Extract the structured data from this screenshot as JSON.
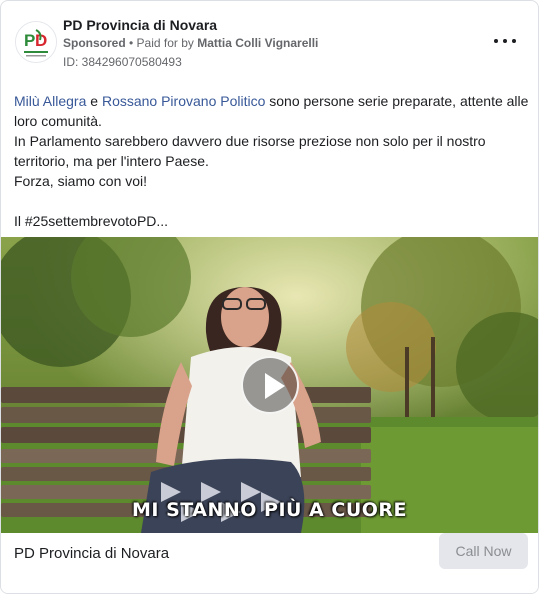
{
  "post": {
    "page_name": "PD Provincia di Novara",
    "sponsored": "Sponsored",
    "separator": " • ",
    "paid_for_prefix": "Paid for by ",
    "paid_for_name": "Mattia Colli Vignarelli",
    "ad_id": "ID: 384296070580493",
    "more_icon": "more-horizontal-icon"
  },
  "body": {
    "link1": "Milù Allegra",
    "and_word": " e ",
    "link2": "Rossano Pirovano Politico",
    "line1_rest": " sono persone serie preparate, attente alle loro comunità.",
    "line2": "In Parlamento sarebbero davvero due risorse preziose non solo per il nostro territorio, ma per l'intero Paese.",
    "line3": "Forza, siamo con voi!",
    "line4": "Il #25settembrevotoPD..."
  },
  "media": {
    "caption": "MI STANNO PIÙ A CUORE",
    "play_icon": "play-icon"
  },
  "footer": {
    "title": "PD Provincia di Novara",
    "cta_label": "Call Now"
  },
  "colors": {
    "link": "#385898",
    "muted": "#65676b",
    "cta_bg": "#e4e6eb",
    "pd_green": "#2e8b3a",
    "pd_red": "#d7262e"
  }
}
